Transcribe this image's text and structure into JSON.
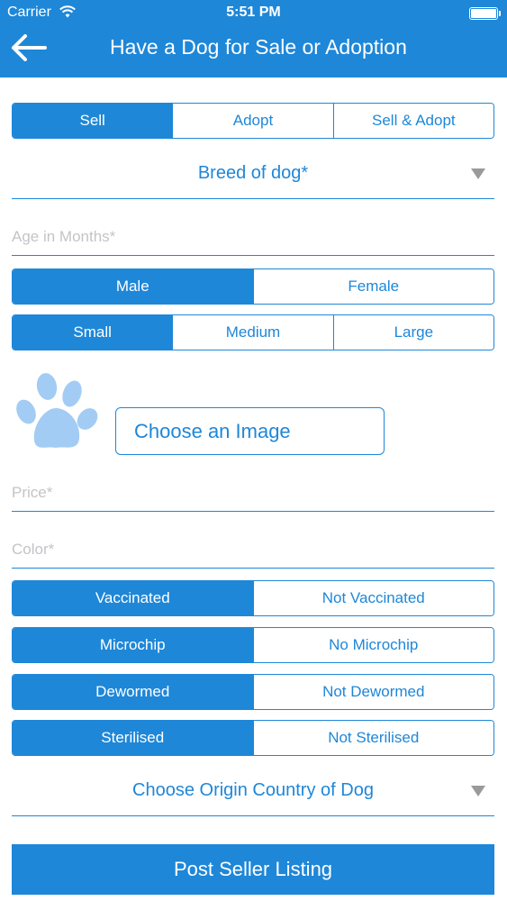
{
  "status_bar": {
    "carrier": "Carrier",
    "time": "5:51 PM"
  },
  "header": {
    "title": "Have a Dog for Sale or Adoption",
    "back_icon": "arrow-left-icon"
  },
  "listing_type": {
    "options": [
      "Sell",
      "Adopt",
      "Sell & Adopt"
    ],
    "selected": "Sell"
  },
  "breed": {
    "label": "Breed of dog*"
  },
  "age": {
    "placeholder": "Age in Months*",
    "value": ""
  },
  "sex": {
    "options": [
      "Male",
      "Female"
    ],
    "selected": "Male"
  },
  "size": {
    "options": [
      "Small",
      "Medium",
      "Large"
    ],
    "selected": "Small"
  },
  "image": {
    "icon": "paw-icon",
    "button_label": "Choose an Image"
  },
  "price": {
    "placeholder": "Price*",
    "value": ""
  },
  "color": {
    "placeholder": "Color*",
    "value": ""
  },
  "vaccination": {
    "options": [
      "Vaccinated",
      "Not Vaccinated"
    ],
    "selected": "Vaccinated"
  },
  "microchip": {
    "options": [
      "Microchip",
      "No Microchip"
    ],
    "selected": "Microchip"
  },
  "deworming": {
    "options": [
      "Dewormed",
      "Not Dewormed"
    ],
    "selected": "Dewormed"
  },
  "sterilisation": {
    "options": [
      "Sterilised",
      "Not Sterilised"
    ],
    "selected": "Sterilised"
  },
  "origin": {
    "label": "Choose Origin Country of Dog"
  },
  "submit": {
    "label": "Post Seller Listing"
  },
  "colors": {
    "primary": "#1e87d8",
    "placeholder": "#c4c4c8",
    "paw": "#a3ccf4",
    "caret": "#9a9a9a"
  }
}
